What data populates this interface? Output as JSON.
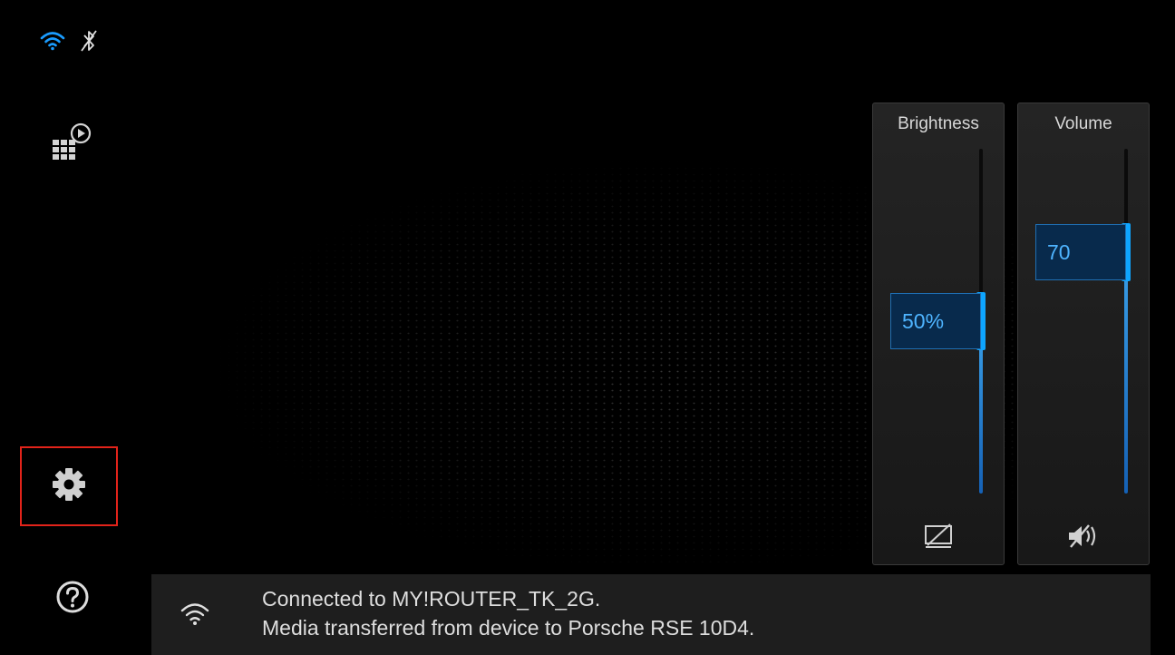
{
  "status_bar": {
    "wifi_icon": "wifi-icon",
    "bluetooth_icon": "bluetooth-off-icon"
  },
  "sidebar": {
    "items": [
      {
        "id": "media-apps",
        "icon": "media-apps-icon"
      },
      {
        "id": "settings",
        "icon": "gear-icon",
        "highlighted": true,
        "highlight_color": "#e2231a"
      },
      {
        "id": "help",
        "icon": "help-icon"
      }
    ]
  },
  "brightness": {
    "title": "Brightness",
    "value_label": "50%",
    "level": 0.5,
    "icon": "display-off-icon"
  },
  "volume": {
    "title": "Volume",
    "value_label": "70",
    "level": 0.7,
    "icon": "mute-icon"
  },
  "notification": {
    "icon": "wifi-icon",
    "line1": "Connected to MY!ROUTER_TK_2G.",
    "line2": "Media transferred from device to Porsche RSE 10D4."
  },
  "colors": {
    "accent": "#0ea5ff",
    "value_bg": "#082a4c",
    "panel_bg": "#1c1c1c"
  }
}
